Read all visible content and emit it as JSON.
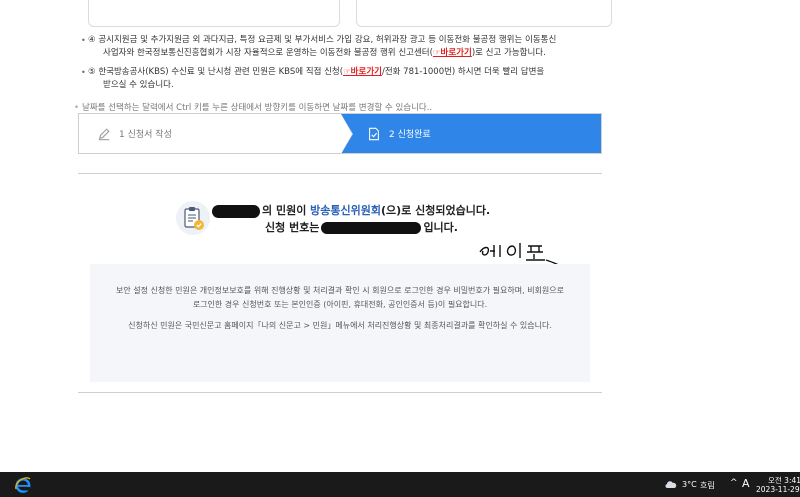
{
  "notices": [
    {
      "bullet": "•",
      "pre": "④ 공시지원금 및 추가지원금 외 과다지급, 특정 요금제 및 부가서비스 가입 강요, 허위과장 광고 등 이동전화 불공정 행위는 이동통신",
      "line2_pre": "사업자와 한국정보통신진흥협회가 시장 자율적으로 운영하는 이동전화 불공정 행위 신고센터(",
      "link": "☞바로가기",
      "line2_post": ")로 신고 가능합니다."
    },
    {
      "bullet": "•",
      "pre": "⑤ 한국방송공사(KBS) 수신료 및 난시청 관련 민원은 KBS에 직접 신청(",
      "link": "☞바로가기",
      "post": "/전화 781-1000번) 하시면 더욱 빨리 답변을",
      "line2": "받으실 수 있습니다."
    }
  ],
  "calendar_hint": "날짜를 선택하는 달력에서 Ctrl 키를 누른 상태에서 방향키를 이동하면 날짜를 변경할 수 있습니다..",
  "steps": [
    {
      "label": "1 신청서 작성",
      "icon": "pencil-icon"
    },
    {
      "label": "2 신청완료",
      "icon": "document-check-icon"
    }
  ],
  "result": {
    "line1_post": "의 민원이 ",
    "agency": "방송통신위원회",
    "line1_end": "(으)로 신청되었습니다.",
    "line2_pre": "신청 번호는",
    "line2_post": "입니다.",
    "icon": "clipboard-check-icon"
  },
  "info": {
    "p1": "보안 설정 신청한 민원은 개인정보보호를 위해 진행상황 및 처리결과 확인 시 회원으로 로그인한 경우 비밀번호가 필요하며, 비회원으로 로그인한 경우 신청번호 또는 본인인증 (아이핀, 휴대전화, 공인인증서 등)이 필요합니다.",
    "p2": "신청하신 민원은 국민신문고 홈페이지「나의 신문고 > 민원」메뉴에서 처리진행상황 및 최종처리결과를 확인하실 수 있습니다."
  },
  "taskbar": {
    "temperature": "3°C",
    "weather": "흐림",
    "chevron": "^",
    "ime": "A",
    "time": "오전 3:41",
    "date": "2023-11-29"
  },
  "colors": {
    "accent": "#2f86e8",
    "link_red": "#e02020",
    "agency_blue": "#2a5fb8",
    "taskbar": "#1a1a1a"
  }
}
